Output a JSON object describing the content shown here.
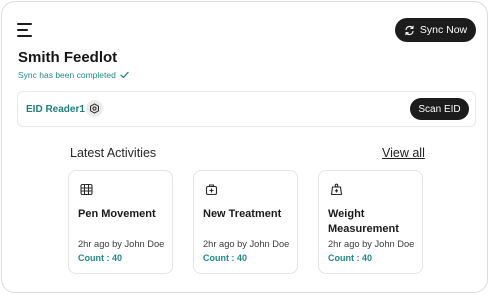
{
  "header": {
    "sync_button_label": "Sync Now"
  },
  "farm": {
    "title": "Smith Feedlot",
    "sync_status": "Sync has been completed"
  },
  "reader": {
    "name": "EID Reader1",
    "scan_label": "Scan EID"
  },
  "activities": {
    "section_title": "Latest Activities",
    "view_all_label": "View all",
    "items": [
      {
        "icon": "pen-fence-icon",
        "name": "Pen Movement",
        "meta": "2hr ago by John Doe",
        "count": "Count : 40"
      },
      {
        "icon": "medical-kit-icon",
        "name": "New Treatment",
        "meta": "2hr ago by John Doe",
        "count": "Count : 40"
      },
      {
        "icon": "weight-icon",
        "name": "Weight Measurement",
        "meta": "2hr ago by John Doe",
        "count": "Count : 40"
      }
    ]
  },
  "colors": {
    "accent_teal": "#1f8a82",
    "button_dark": "#1c1c1c"
  }
}
